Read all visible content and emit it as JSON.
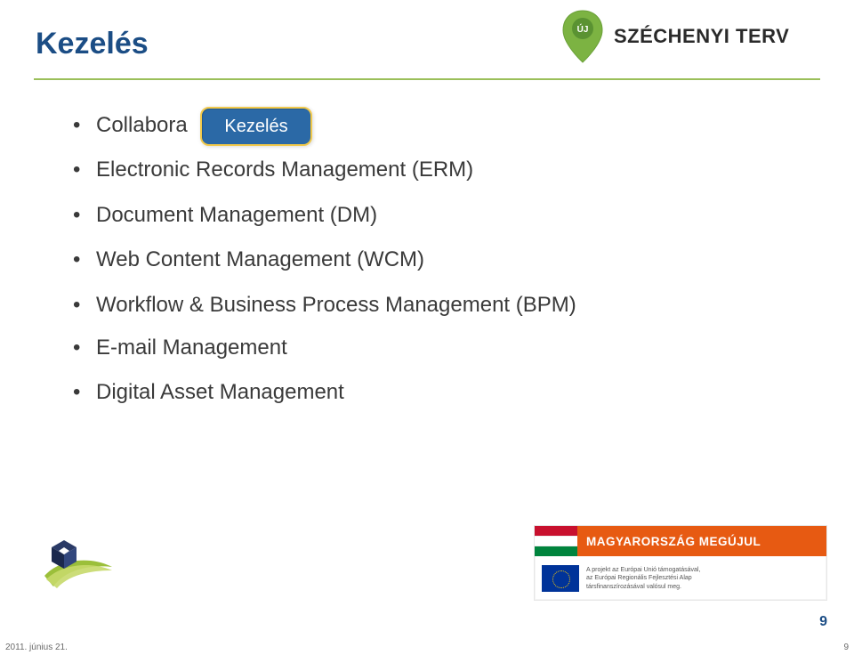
{
  "title": "Kezelés",
  "callout_label": "Kezelés",
  "bullets": [
    "Collabora",
    "Electronic Records Management (ERM)",
    "Document Management (DM)",
    "Web Content Management (WCM)",
    "Workflow & Business Process Management (BPM)",
    "E-mail Management",
    "Digital Asset Management"
  ],
  "top_logo": {
    "badge": "ÚJ",
    "text": "SZÉCHENYI TERV"
  },
  "footer": {
    "headline": "MAGYARORSZÁG MEGÚJUL",
    "eu_line1": "A projekt az Európai Unió támogatásával,",
    "eu_line2": "az Európai Regionális Fejlesztési Alap",
    "eu_line3": "társfinanszírozásával valósul meg."
  },
  "page_number": "9",
  "notes": {
    "date": "2011. június 21.",
    "page": "9"
  }
}
